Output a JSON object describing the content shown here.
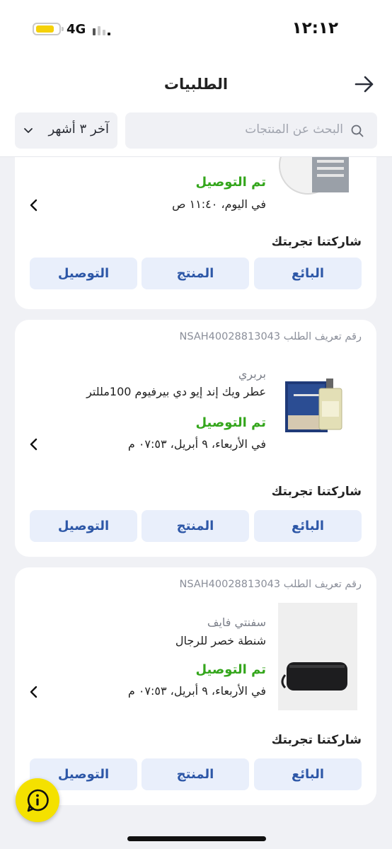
{
  "status_bar": {
    "time": "١٢:١٢",
    "network": "4G",
    "battery_color": "#f5d10a"
  },
  "header": {
    "title": "الطلبيات",
    "search_placeholder": "البحث عن المنتجات",
    "filter_label": "آخر ٣ أشهر",
    "icons": {
      "back": "arrow-right-icon",
      "search": "search-icon",
      "filter": "chevron-down-icon"
    }
  },
  "orders": [
    {
      "status": "تم التوصيل",
      "date": "في اليوم، ١١:٤٠ ص",
      "share_label": "شاركتنا تجربتك",
      "buttons": {
        "seller": "البائع",
        "product": "المنتج",
        "delivery": "التوصيل"
      }
    },
    {
      "order_id": "رقم تعريف الطلب NSAH40028813043",
      "brand": "بربري",
      "product_name": "عطر ويك إند إيو دي بيرفيوم 100مللتر",
      "status": "تم التوصيل",
      "date": "في الأربعاء، ٩ أبريل، ٠٧:٥٣ م",
      "share_label": "شاركتنا تجربتك",
      "buttons": {
        "seller": "البائع",
        "product": "المنتج",
        "delivery": "التوصيل"
      }
    },
    {
      "order_id": "رقم تعريف الطلب NSAH40028813043",
      "brand": "سفنتي فايف",
      "product_name": "شنطة خصر للرجال",
      "status": "تم التوصيل",
      "date": "في الأربعاء، ٩ أبريل، ٠٧:٥٣ م",
      "share_label": "شاركتنا تجربتك",
      "buttons": {
        "seller": "البائع",
        "product": "المنتج",
        "delivery": "التوصيل"
      }
    }
  ],
  "colors": {
    "accent": "#2d57a7",
    "delivered": "#34a61c",
    "button_bg": "#e9effb",
    "help_fab": "#f4e100"
  },
  "help_icon": "info-icon"
}
